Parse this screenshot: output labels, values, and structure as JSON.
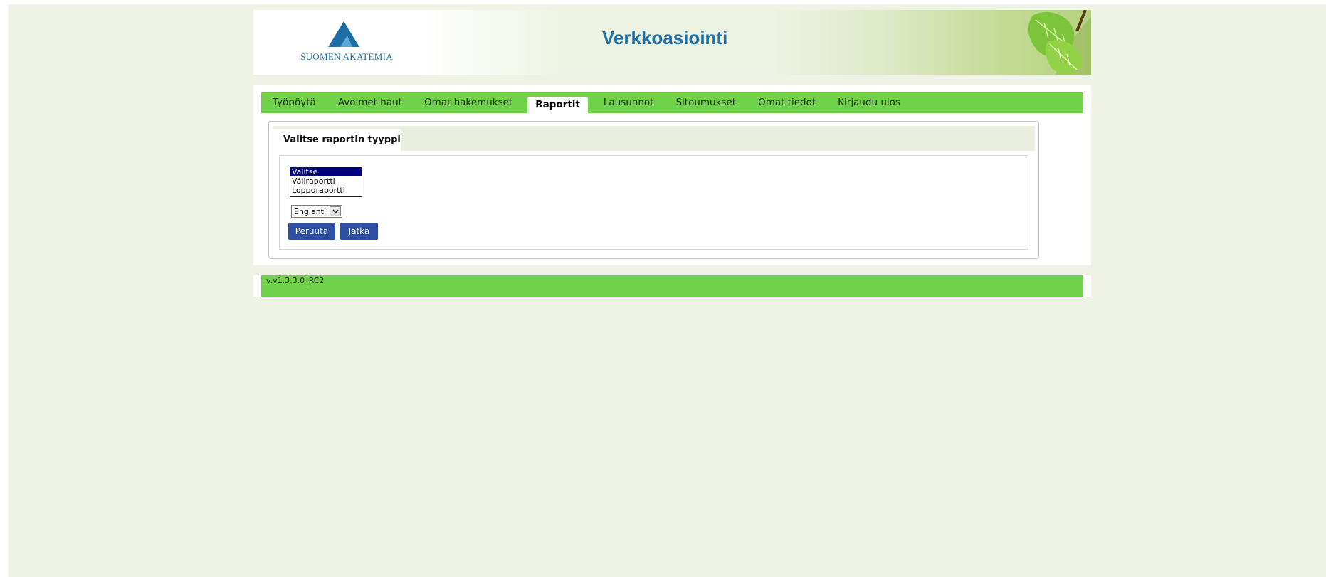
{
  "header": {
    "logo_text": "SUOMEN AKATEMIA",
    "title": "Verkkoasiointi"
  },
  "nav": {
    "items": [
      "Työpöytä",
      "Avoimet haut",
      "Omat hakemukset",
      "Raportit",
      "Lausunnot",
      "Sitoumukset",
      "Omat tiedot",
      "Kirjaudu ulos"
    ],
    "active": "Raportit"
  },
  "tabs": {
    "active_label": "Valitse raportin tyyppi"
  },
  "form": {
    "report_type_options": [
      "Valitse",
      "Väliraportti",
      "Loppuraportti"
    ],
    "report_type_selected": "Valitse",
    "language_value": "Englanti",
    "cancel_label": "Peruuta",
    "continue_label": "Jatka"
  },
  "footer": {
    "version": "v.v1.3.3.0_RC2"
  },
  "colors": {
    "nav_green": "#6fd24a",
    "brand_blue": "#1e6ea8",
    "button_blue": "#2f4fa3",
    "page_bg": "#eff3e5"
  }
}
